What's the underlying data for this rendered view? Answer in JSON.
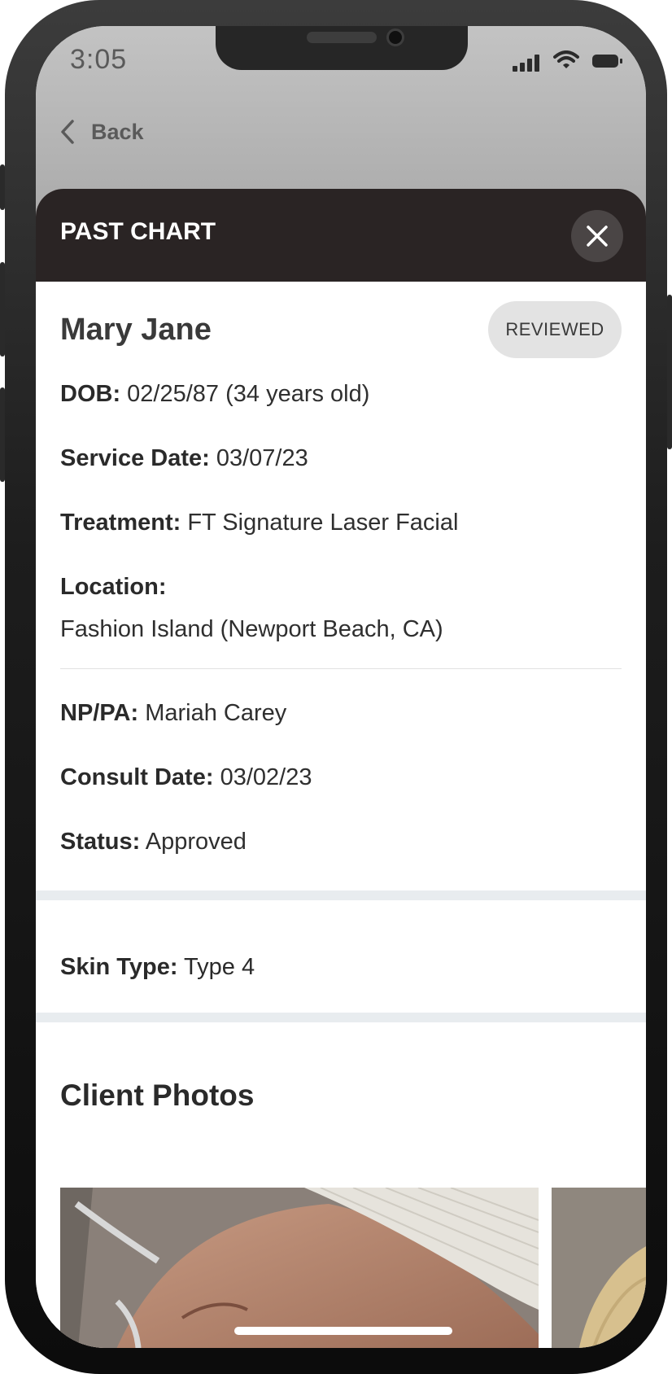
{
  "status_bar": {
    "time": "3:05"
  },
  "nav": {
    "back_label": "Back"
  },
  "sheet": {
    "title": "PAST CHART"
  },
  "client": {
    "name": "Mary Jane",
    "badge": "REVIEWED",
    "fields": {
      "dob": {
        "label": "DOB:",
        "value": "02/25/87 (34 years old)"
      },
      "service_date": {
        "label": "Service Date:",
        "value": "03/07/23"
      },
      "treatment": {
        "label": "Treatment:",
        "value": "FT Signature Laser Facial"
      },
      "location": {
        "label": "Location:",
        "value": "Fashion Island (Newport Beach, CA)"
      },
      "np_pa": {
        "label": "NP/PA:",
        "value": "Mariah Carey"
      },
      "consult_date": {
        "label": "Consult Date:",
        "value": "03/02/23"
      },
      "status": {
        "label": "Status:",
        "value": "Approved"
      }
    }
  },
  "skin": {
    "label": "Skin Type:",
    "value": "Type 4"
  },
  "photos": {
    "title": "Client Photos"
  },
  "icons": {
    "back": "chevron-left-icon",
    "close": "close-icon",
    "signal": "signal-icon",
    "wifi": "wifi-icon",
    "battery": "battery-icon"
  },
  "colors": {
    "header_bg": "#2a2424",
    "badge_bg": "#e3e3e3",
    "band": "#e8ecef"
  }
}
